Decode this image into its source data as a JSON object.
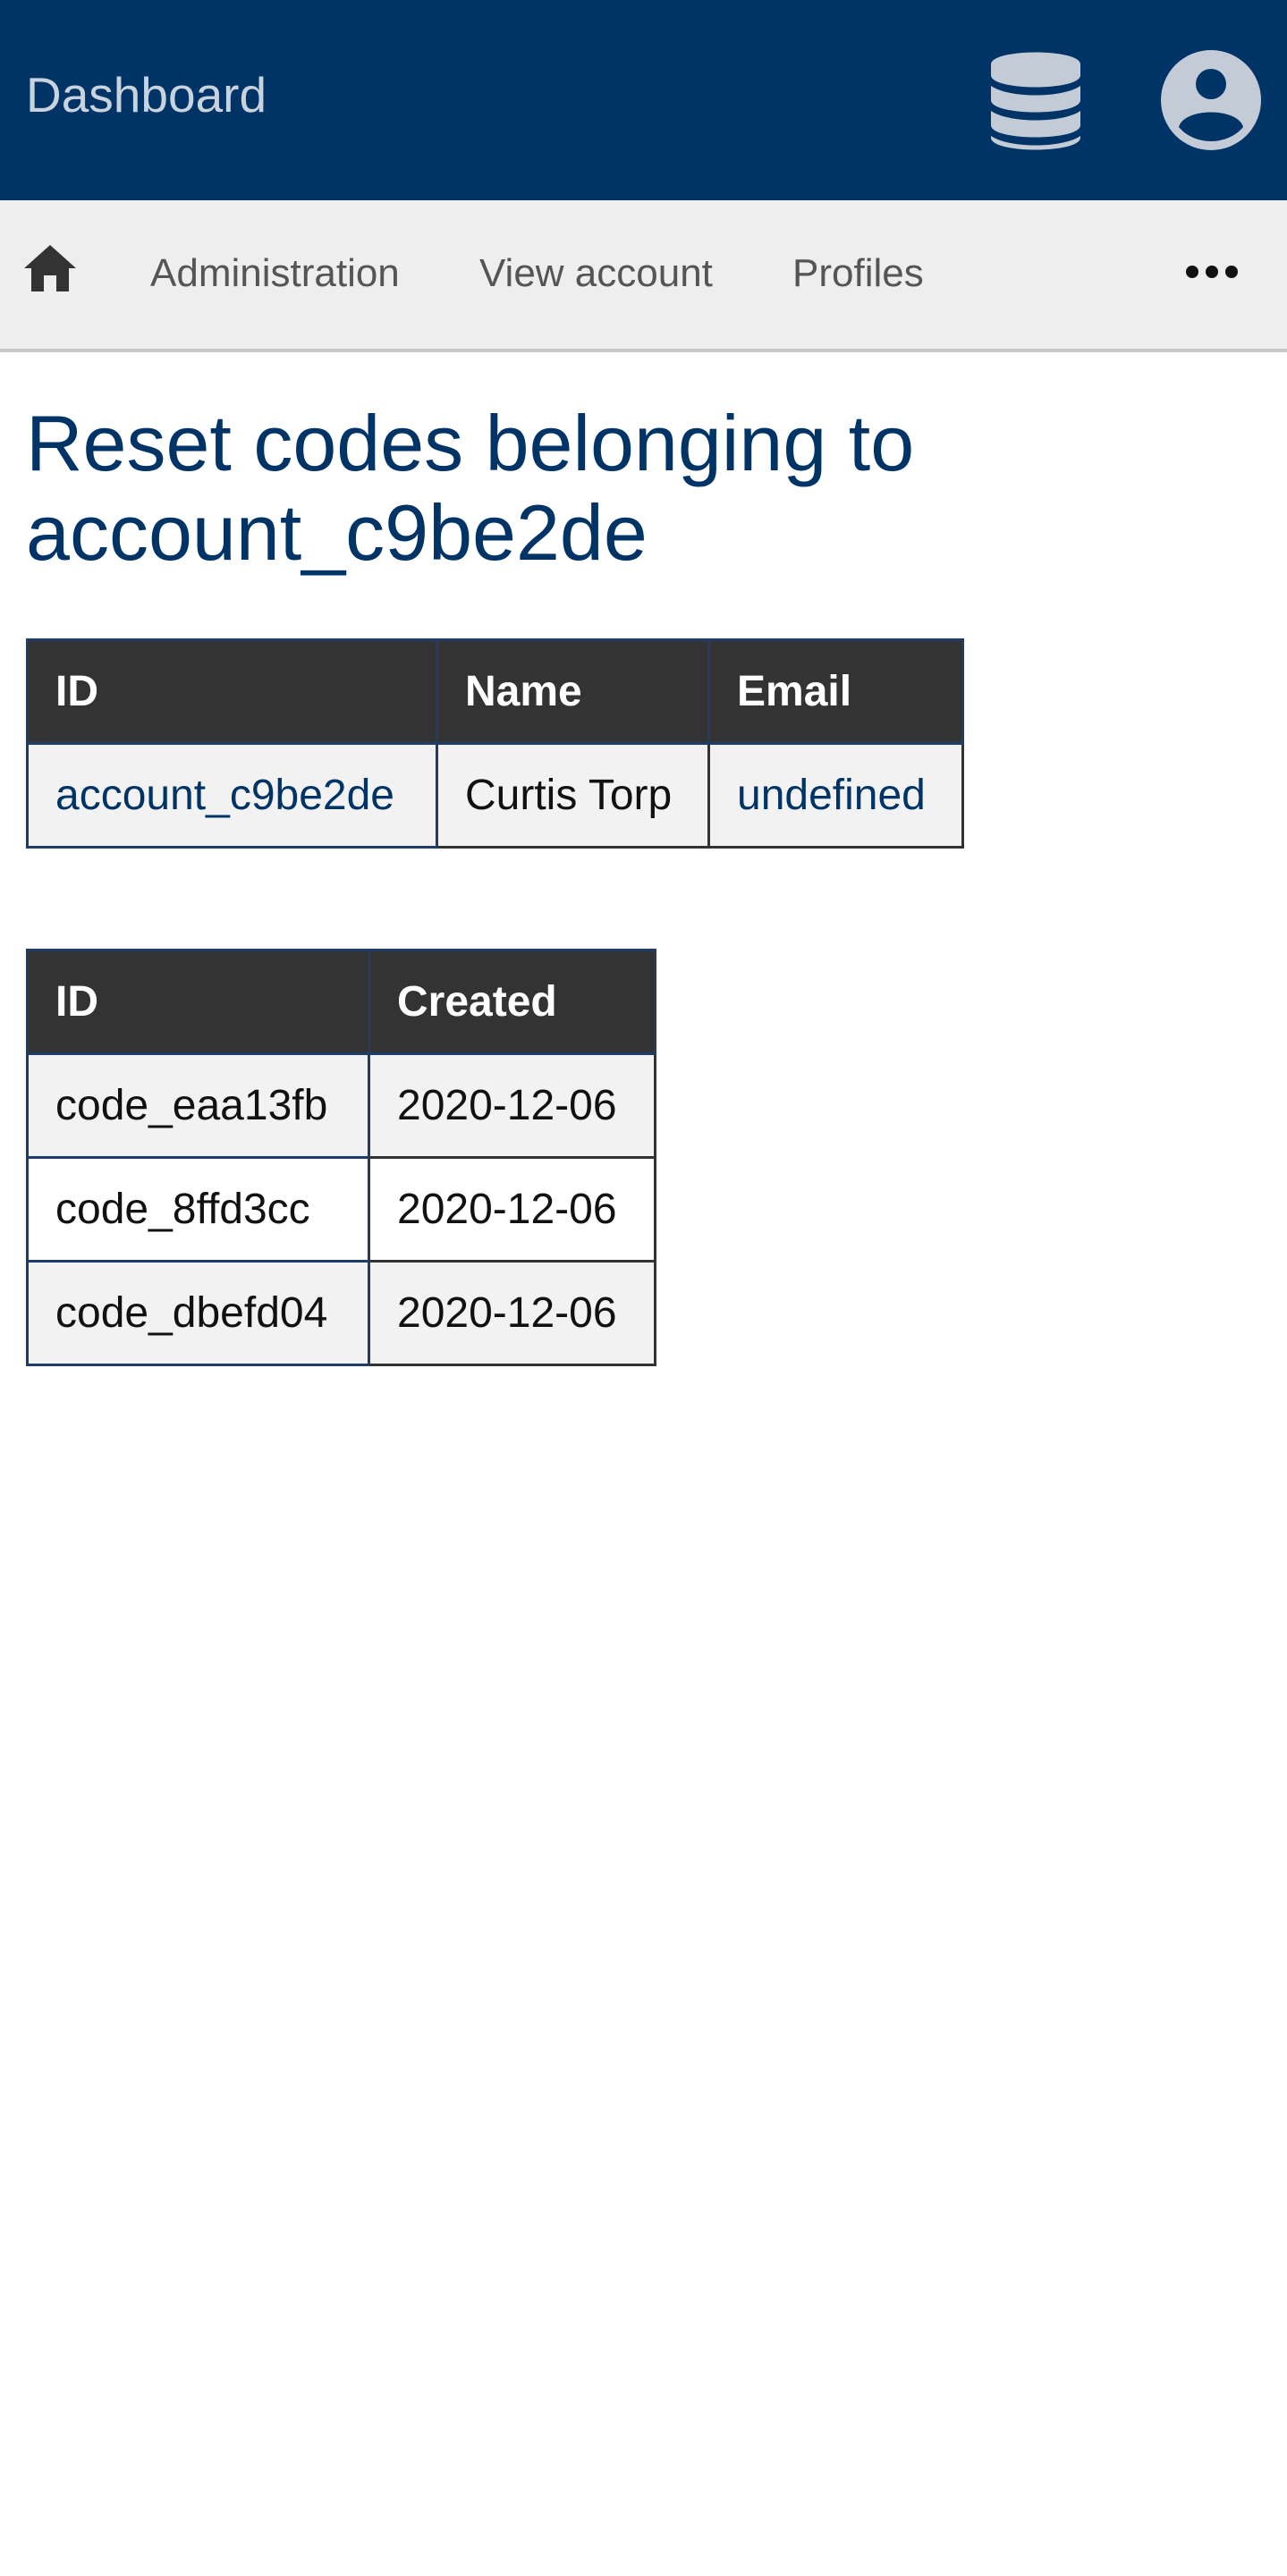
{
  "header": {
    "title": "Dashboard",
    "icons": [
      "database-icon",
      "user-circle-icon"
    ]
  },
  "nav": {
    "home_icon": "home-icon",
    "items": [
      {
        "label": "Administration"
      },
      {
        "label": "View account"
      },
      {
        "label": "Profiles"
      }
    ],
    "more_icon": "ellipsis-icon"
  },
  "page": {
    "title": "Reset codes belonging to account_c9be2de"
  },
  "account_table": {
    "headers": [
      "ID",
      "Name",
      "Email"
    ],
    "row": {
      "id": "account_c9be2de",
      "name": "Curtis Torp",
      "email": "undefined"
    }
  },
  "codes_table": {
    "headers": [
      "ID",
      "Created"
    ],
    "rows": [
      {
        "id": "code_eaa13fb",
        "created": "2020-12-06"
      },
      {
        "id": "code_8ffd3cc",
        "created": "2020-12-06"
      },
      {
        "id": "code_dbefd04",
        "created": "2020-12-06"
      }
    ]
  },
  "colors": {
    "header_bg": "#003366",
    "nav_bg": "#eeeeee",
    "table_header_bg": "#333333",
    "link": "#003366"
  }
}
